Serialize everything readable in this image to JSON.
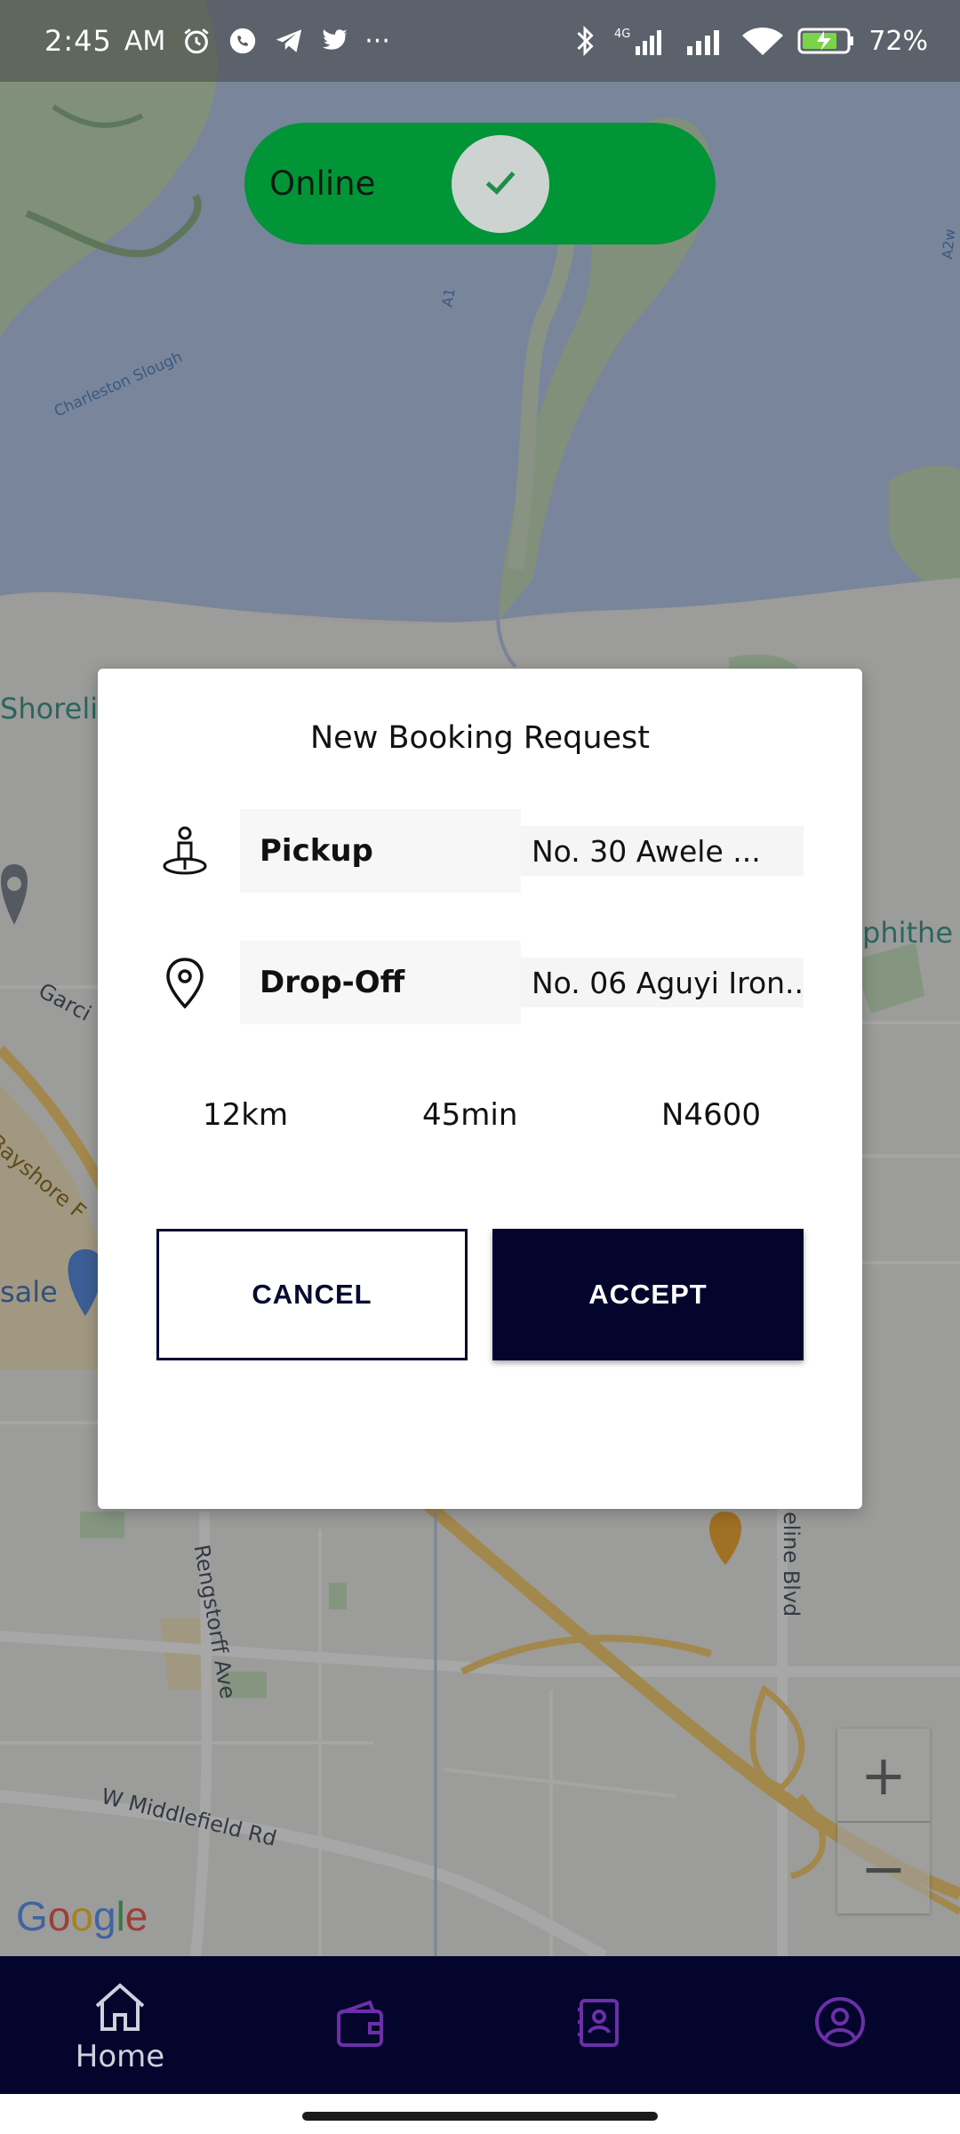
{
  "status_bar": {
    "time": "2:45",
    "ampm": "AM",
    "more": "···",
    "network": "4G",
    "battery": "72%"
  },
  "toggle": {
    "label": "Online",
    "state": "on",
    "color": "#019538"
  },
  "map": {
    "labels": {
      "slough": "Charleston Slough",
      "road_a1": "A1",
      "road_a2": "A2w",
      "shoreline": "Shoreli",
      "amphitheatre": "phithe",
      "garcia": "Garci",
      "bayshore": "Bayshore F",
      "sale": "sale",
      "rengstorff": "Rengstorff Ave",
      "middlefield": "W Middlefield Rd",
      "shoreline_blvd": "eline Blvd"
    },
    "zoom_in": "+",
    "zoom_out": "−",
    "attribution": [
      "G",
      "o",
      "o",
      "g",
      "l",
      "e"
    ]
  },
  "dialog": {
    "title": "New Booking Request",
    "pickup": {
      "label": "Pickup",
      "value": "No. 30 Awele ..."
    },
    "dropoff": {
      "label": "Drop-Off",
      "value": "No. 06 Aguyi Iron..."
    },
    "distance": "12km",
    "duration": "45min",
    "fare": "N4600",
    "cancel_label": "CANCEL",
    "accept_label": "ACCEPT",
    "accent": "#04052d"
  },
  "bottom_nav": {
    "items": [
      {
        "label": "Home",
        "icon": "home-icon"
      },
      {
        "label": "",
        "icon": "wallet-icon"
      },
      {
        "label": "",
        "icon": "contacts-icon"
      },
      {
        "label": "",
        "icon": "profile-icon"
      }
    ]
  }
}
